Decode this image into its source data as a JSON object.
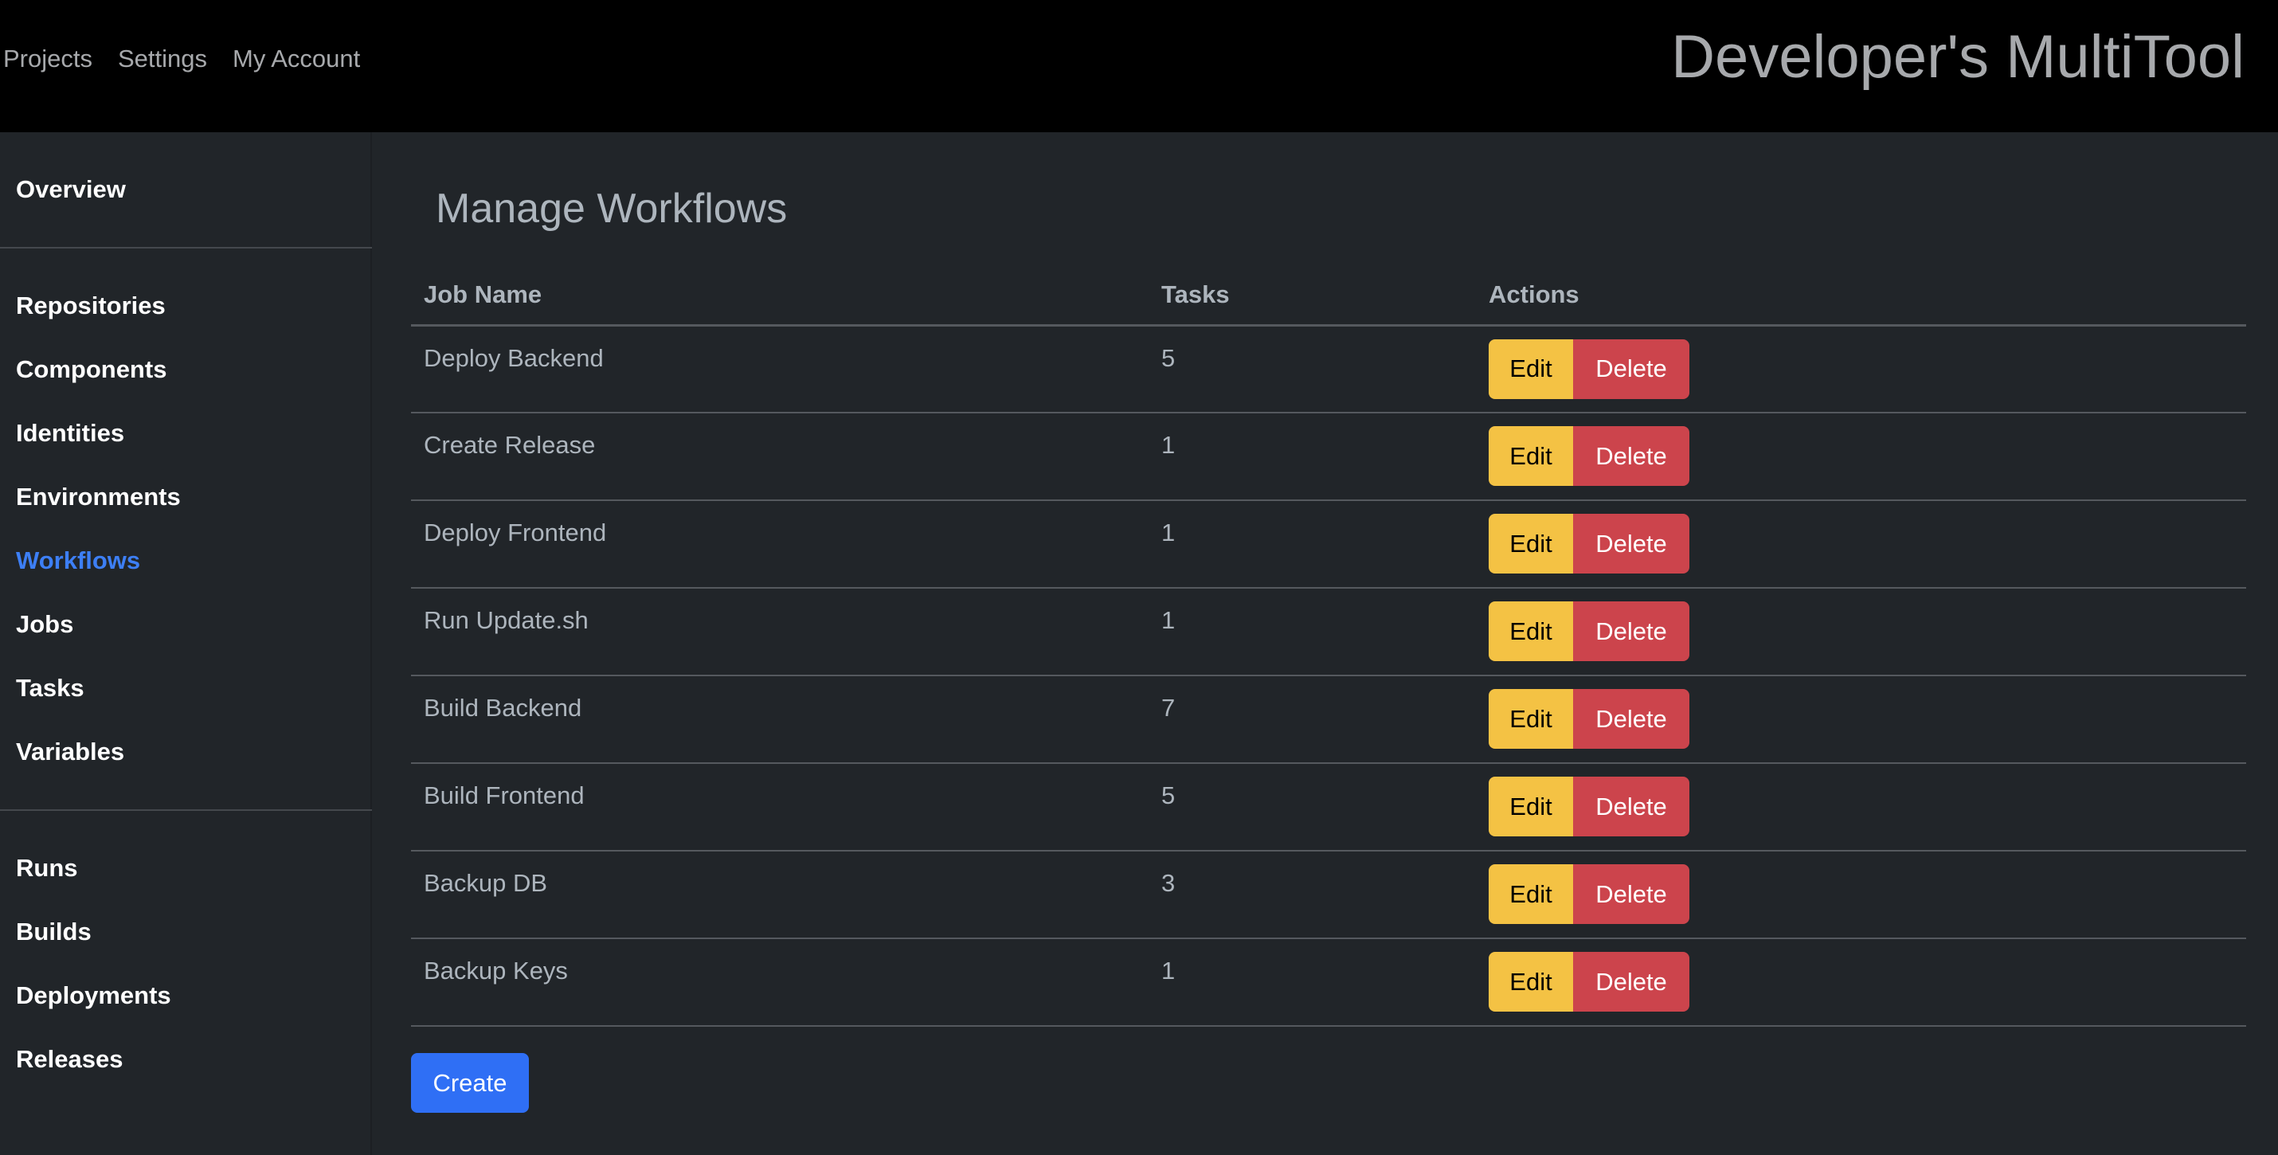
{
  "topbar": {
    "nav": [
      "Projects",
      "Settings",
      "My Account"
    ],
    "brand": "Developer's MultiTool"
  },
  "sidebar": {
    "items": [
      "Overview",
      "Repositories",
      "Components",
      "Identities",
      "Environments",
      "Workflows",
      "Jobs",
      "Tasks",
      "Variables",
      "Runs",
      "Builds",
      "Deployments",
      "Releases"
    ],
    "active": "Workflows"
  },
  "main": {
    "title": "Manage Workflows",
    "columns": [
      "Job Name",
      "Tasks",
      "Actions"
    ],
    "rows": [
      {
        "name": "Deploy Backend",
        "tasks": "5"
      },
      {
        "name": "Create Release",
        "tasks": "1"
      },
      {
        "name": "Deploy Frontend",
        "tasks": "1"
      },
      {
        "name": "Run Update.sh",
        "tasks": "1"
      },
      {
        "name": "Build Backend",
        "tasks": "7"
      },
      {
        "name": "Build Frontend",
        "tasks": "5"
      },
      {
        "name": "Backup DB",
        "tasks": "3"
      },
      {
        "name": "Backup Keys",
        "tasks": "1"
      }
    ],
    "edit_label": "Edit",
    "delete_label": "Delete",
    "create_label": "Create"
  },
  "colors": {
    "edit": "#f4c244",
    "delete": "#cc444c",
    "primary": "#2f6ff5",
    "active_link": "#3d7ff5"
  }
}
